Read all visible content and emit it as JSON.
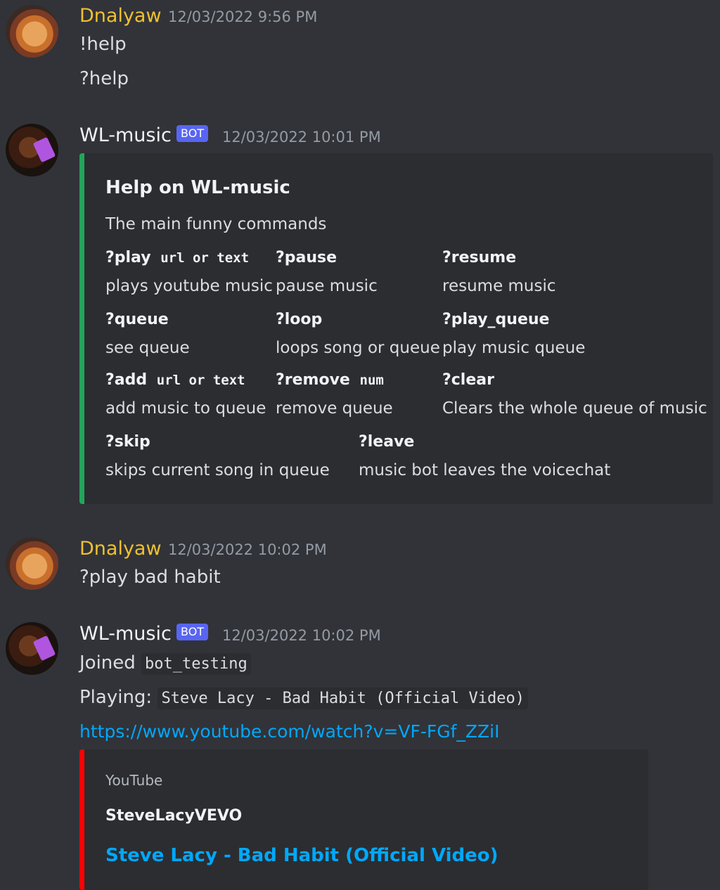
{
  "messages": [
    {
      "author": "Dnalyaw",
      "timestamp": "12/03/2022 9:56 PM",
      "lines": [
        "!help",
        "?help"
      ]
    },
    {
      "author": "WL-music",
      "bot_tag": "BOT",
      "timestamp": "12/03/2022 10:01 PM",
      "embed": {
        "title": "Help on WL-music",
        "description": "The main funny commands",
        "accent_color": "#23a55a",
        "fields": [
          {
            "name": "?play",
            "arg": "url or text",
            "value": "plays youtube music"
          },
          {
            "name": "?pause",
            "value": "pause music"
          },
          {
            "name": "?resume",
            "value": "resume music"
          },
          {
            "name": "?queue",
            "value": "see queue"
          },
          {
            "name": "?loop",
            "value": "loops song or queue"
          },
          {
            "name": "?play_queue",
            "value": "play music queue"
          },
          {
            "name": "?add",
            "arg": "url or text",
            "value": "add music to queue"
          },
          {
            "name": "?remove",
            "arg": "num",
            "value": "remove queue"
          },
          {
            "name": "?clear",
            "value": "Clears the whole queue of music"
          },
          {
            "name": "?skip",
            "value": "skips current song in queue"
          },
          {
            "name": "?leave",
            "value": "music bot leaves the voicechat"
          }
        ]
      }
    },
    {
      "author": "Dnalyaw",
      "timestamp": "12/03/2022 10:02 PM",
      "lines": [
        "?play bad habit"
      ]
    },
    {
      "author": "WL-music",
      "bot_tag": "BOT",
      "timestamp": "12/03/2022 10:02 PM",
      "joined_prefix": "Joined",
      "joined_channel": "bot_testing",
      "playing_prefix": "Playing:",
      "playing_title": "Steve Lacy - Bad Habit (Official Video)",
      "link": "https://www.youtube.com/watch?v=VF-FGf_ZZiI",
      "link_embed": {
        "provider": "YouTube",
        "author": "SteveLacyVEVO",
        "title": "Steve Lacy - Bad Habit (Official Video)",
        "accent_color": "#ff0000"
      }
    }
  ],
  "icons": {
    "dnalyaw_avatar": "avatar-dnalyaw",
    "bot_avatar": "avatar-wl-music"
  }
}
